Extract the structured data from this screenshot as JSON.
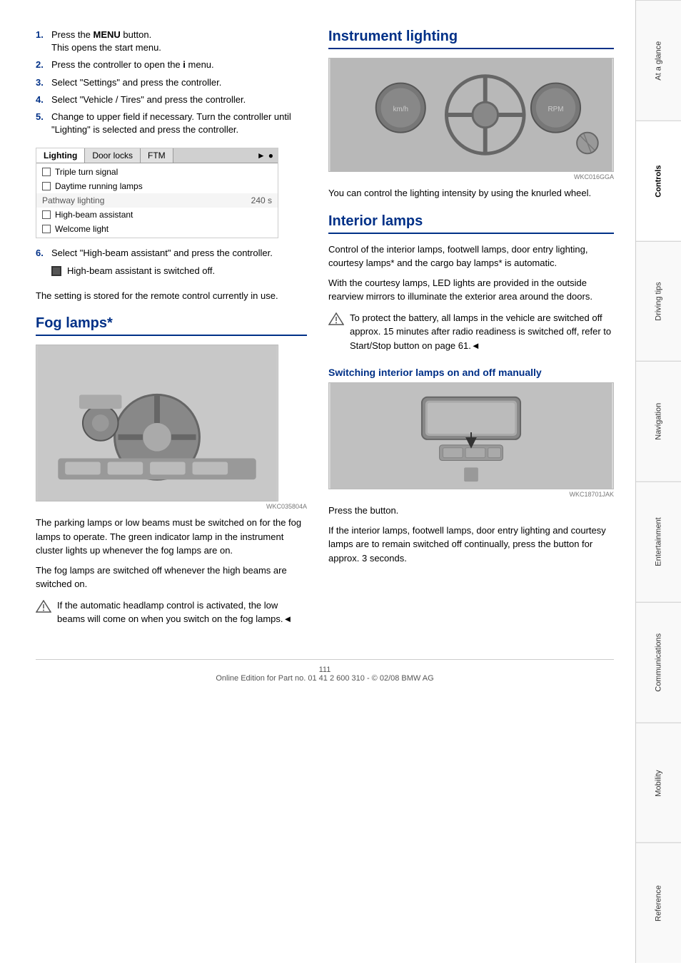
{
  "page": {
    "number": "111",
    "footer_text": "Online Edition for Part no. 01 41 2 600 310 - © 02/08 BMW AG"
  },
  "sidebar": {
    "sections": [
      {
        "id": "at-a-glance",
        "label": "At a glance",
        "active": false
      },
      {
        "id": "controls",
        "label": "Controls",
        "active": true
      },
      {
        "id": "driving-tips",
        "label": "Driving tips",
        "active": false
      },
      {
        "id": "navigation",
        "label": "Navigation",
        "active": false
      },
      {
        "id": "entertainment",
        "label": "Entertainment",
        "active": false
      },
      {
        "id": "communications",
        "label": "Communications",
        "active": false
      },
      {
        "id": "mobility",
        "label": "Mobility",
        "active": false
      },
      {
        "id": "reference",
        "label": "Reference",
        "active": false
      }
    ]
  },
  "left_column": {
    "steps": [
      {
        "num": "1.",
        "text": "Press the MENU button.\nThis opens the start menu."
      },
      {
        "num": "2.",
        "text": "Press the controller to open the i menu."
      },
      {
        "num": "3.",
        "text": "Select \"Settings\" and press the controller."
      },
      {
        "num": "4.",
        "text": "Select \"Vehicle / Tires\" and press the controller."
      },
      {
        "num": "5.",
        "text": "Change to upper field if necessary. Turn the controller until \"Lighting\" is selected and press the controller."
      }
    ],
    "menu": {
      "tabs": [
        "Lighting",
        "Door locks",
        "FTM"
      ],
      "selected_tab": "Lighting",
      "items": [
        {
          "type": "checkbox",
          "label": "Triple turn signal"
        },
        {
          "type": "checkbox",
          "label": "Daytime running lamps"
        },
        {
          "type": "pathway",
          "label": "Pathway lighting",
          "value": "240 s"
        },
        {
          "type": "checkbox",
          "label": "High-beam assistant"
        },
        {
          "type": "checkbox",
          "label": "Welcome light"
        }
      ]
    },
    "step6": {
      "num": "6.",
      "text": "Select \"High-beam assistant\" and press the controller.",
      "note": "High-beam assistant is switched off."
    },
    "stored_text": "The setting is stored for the remote control currently in use.",
    "fog_section": {
      "title": "Fog lamps*",
      "image_label": "WKC035804A",
      "description1": "The parking lamps or low beams must be switched on for the fog lamps to operate. The green indicator lamp in the instrument cluster lights up whenever the fog lamps are on.",
      "description2": "The fog lamps are switched off whenever the high beams are switched on.",
      "note_text": "If the automatic headlamp control is activated, the low beams will come on when you switch on the fog lamps.◄"
    }
  },
  "right_column": {
    "instrument_lighting": {
      "title": "Instrument lighting",
      "image_label": "WKC016GGA",
      "description": "You can control the lighting intensity by using the knurled wheel."
    },
    "interior_lamps": {
      "title": "Interior lamps",
      "description1": "Control of the interior lamps, footwell lamps, door entry lighting, courtesy lamps* and the cargo bay lamps* is automatic.",
      "description2": "With the courtesy lamps, LED lights are provided in the outside rearview mirrors to illuminate the exterior area around the doors.",
      "note_text": "To protect the battery, all lamps in the vehicle are switched off approx. 15 minutes after radio readiness is switched off, refer to Start/Stop button on page 61.◄",
      "switching_title": "Switching interior lamps on and off manually",
      "image_label": "WKC18701JAK",
      "press_text": "Press the button.",
      "continual_text": "If the interior lamps, footwell lamps, door entry lighting and courtesy lamps are to remain switched off continually, press the button for approx. 3 seconds."
    }
  }
}
